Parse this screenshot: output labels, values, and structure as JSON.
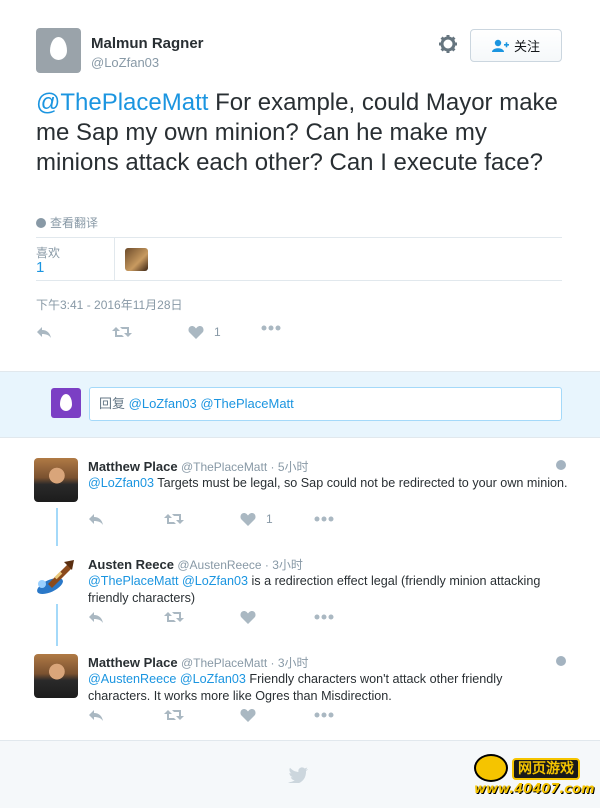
{
  "tweet": {
    "author_name": "Malmun Ragner",
    "author_handle": "@LoZfan03",
    "follow_label": "关注",
    "mention": "@ThePlaceMatt",
    "text": " For example, could Mayor make me Sap my own minion?  Can he make my minions attack each other?  Can I execute face?",
    "translate_label": "查看翻译",
    "likes_label": "喜欢",
    "likes_count": "1",
    "timestamp": "下午3:41 - 2016年11月28日",
    "like_action_count": "1"
  },
  "reply_box": {
    "prefix": "回复",
    "mentions": "@LoZfan03 @ThePlaceMatt"
  },
  "replies": [
    {
      "name": "Matthew Place",
      "handle": "@ThePlaceMatt",
      "time": "· 5小时",
      "mention": "@LoZfan03",
      "text": " Targets must be legal, so Sap could not be redirected to your own minion.",
      "like_count": "1"
    },
    {
      "name": "Austen Reece",
      "handle": "@AustenReece",
      "time": "· 3小时",
      "mention": "@ThePlaceMatt @LoZfan03",
      "text": " is a redirection effect legal (friendly minion attacking friendly characters)",
      "like_count": ""
    },
    {
      "name": "Matthew Place",
      "handle": "@ThePlaceMatt",
      "time": "· 3小时",
      "mention": "@AustenReece @LoZfan03",
      "text": " Friendly characters won't attack other friendly characters. It works more like Ogres than Misdirection.",
      "like_count": ""
    }
  ],
  "watermark": {
    "top": "网页游戏",
    "bottom": "www.40407.com"
  },
  "colors": {
    "link": "#1b95e0",
    "muted": "#8899a6",
    "reply_bg": "#e8f5fd"
  }
}
